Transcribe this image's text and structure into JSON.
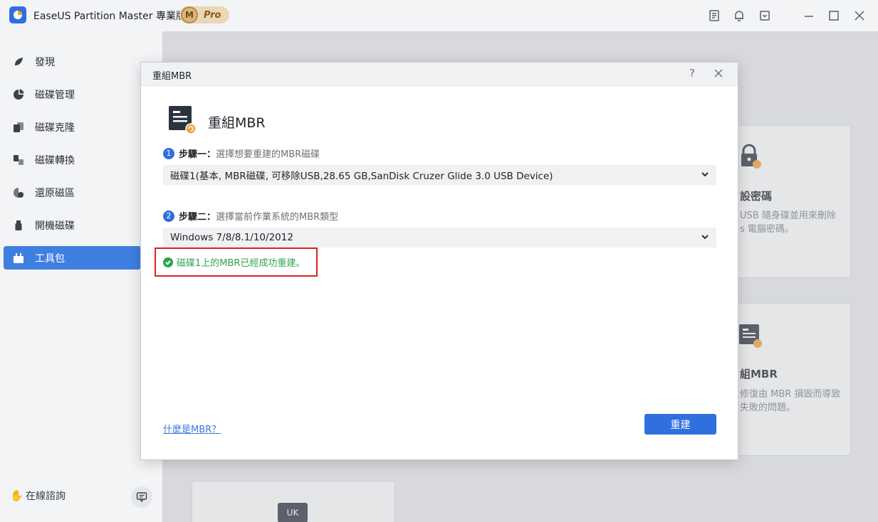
{
  "app": {
    "title": "EaseUS Partition Master 專業版",
    "badge_letter": "M",
    "badge_text": "Pro",
    "icons": [
      "notes-icon",
      "bell-icon",
      "download-icon",
      "minimize-icon",
      "maximize-icon",
      "close-icon"
    ]
  },
  "sidebar": {
    "items": [
      {
        "label": "發現",
        "icon": "leaf-icon"
      },
      {
        "label": "磁碟管理",
        "icon": "pie-chart-icon"
      },
      {
        "label": "磁碟克隆",
        "icon": "clone-icon"
      },
      {
        "label": "磁碟轉換",
        "icon": "convert-icon"
      },
      {
        "label": "還原磁區",
        "icon": "recover-icon"
      },
      {
        "label": "開機磁碟",
        "icon": "usb-icon"
      },
      {
        "label": "工具包",
        "icon": "toolbox-icon",
        "active": true
      }
    ],
    "online_label": "在線諮詢"
  },
  "background": {
    "cards": [
      {
        "title": "設密碼",
        "desc": [
          "USB 隨身碟並用來刪除",
          "s 電腦密碼。"
        ]
      },
      {
        "title": "組MBR",
        "desc": [
          "修復由 MBR 損毀而導致",
          "失敗的問題。"
        ]
      }
    ],
    "bottom_card_label": "UK"
  },
  "dialog": {
    "header_title": "重組MBR",
    "help_label": "?",
    "hero_title": "重組MBR",
    "step1": {
      "num": "1",
      "label": "步驟一：",
      "desc": "選擇想要重建的MBR磁碟",
      "selected": "磁碟1(基本, MBR磁碟, 可移除USB,28.65 GB,SanDisk Cruzer Glide 3.0 USB Device)"
    },
    "step2": {
      "num": "2",
      "label": "步驟二：",
      "desc": "選擇當前作業系統的MBR類型",
      "selected": "Windows 7/8/8.1/10/2012"
    },
    "success_message": "磁碟1上的MBR已經成功重建。",
    "link_label": "什麼是MBR？",
    "rebuild_button": "重建",
    "accent_color": "#2f6fde",
    "success_color": "#2ea44f",
    "highlight_color": "#e02020"
  }
}
